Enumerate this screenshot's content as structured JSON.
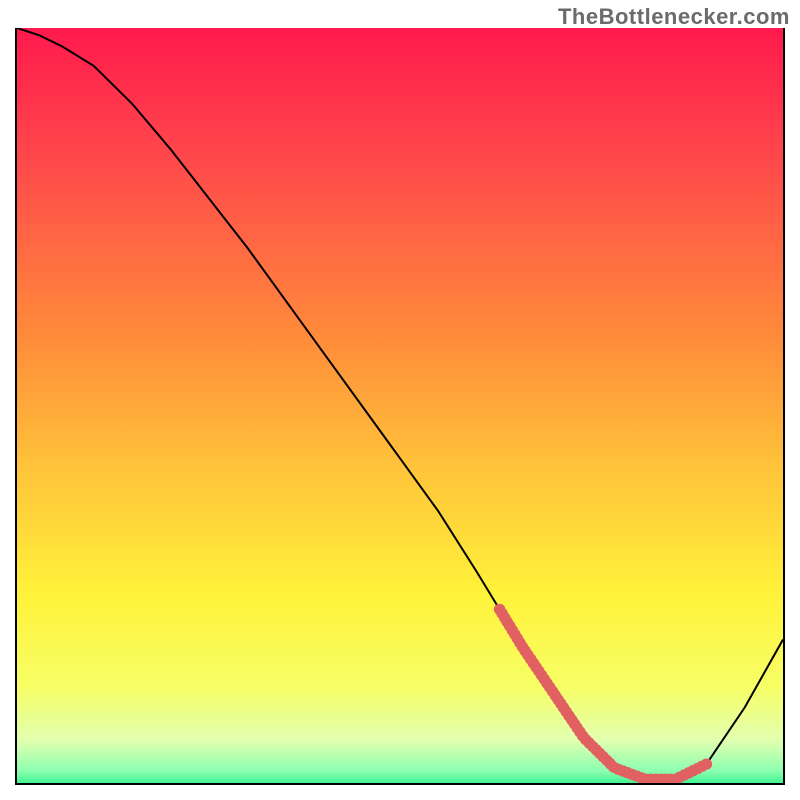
{
  "attribution": "TheBottlenecker.com",
  "chart_data": {
    "type": "line",
    "title": "",
    "xlabel": "",
    "ylabel": "",
    "xlim": [
      0,
      100
    ],
    "ylim": [
      0,
      100
    ],
    "series": [
      {
        "name": "curve",
        "color": "#000000",
        "x": [
          0,
          3,
          6,
          10,
          15,
          20,
          25,
          30,
          35,
          40,
          45,
          50,
          55,
          60,
          63,
          66,
          70,
          74,
          78,
          82,
          86,
          90,
          95,
          100
        ],
        "y": [
          100,
          99,
          97.5,
          95,
          90,
          84,
          77.5,
          71,
          64,
          57,
          50,
          43,
          36,
          28,
          23,
          18,
          12,
          6,
          2,
          0.5,
          0.5,
          2.5,
          10,
          19
        ]
      },
      {
        "name": "highlight-band",
        "color": "#e16062",
        "x": [
          63,
          66,
          70,
          74,
          78,
          82,
          86,
          90
        ],
        "y": [
          23,
          18,
          12,
          6,
          2,
          0.5,
          0.5,
          2.5
        ]
      }
    ],
    "gradient_stops": [
      {
        "offset": 0,
        "color": "#ff1a4d"
      },
      {
        "offset": 18,
        "color": "#ff4b4b"
      },
      {
        "offset": 40,
        "color": "#ff8a3a"
      },
      {
        "offset": 58,
        "color": "#ffc53a"
      },
      {
        "offset": 74,
        "color": "#fff23a"
      },
      {
        "offset": 86,
        "color": "#f7ff66"
      },
      {
        "offset": 93,
        "color": "#e1ffb0"
      },
      {
        "offset": 97,
        "color": "#8cffb0"
      },
      {
        "offset": 100,
        "color": "#00e87a"
      }
    ]
  }
}
